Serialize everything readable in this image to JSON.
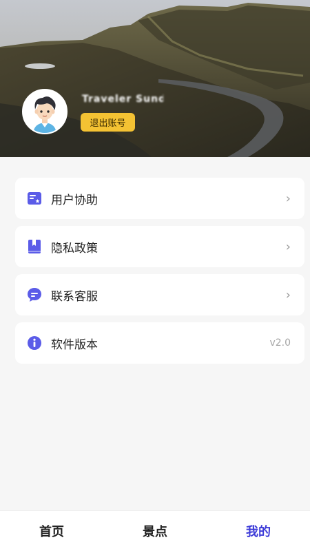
{
  "profile": {
    "username": "Traveler Sunde",
    "logout_label": "退出账号",
    "avatar_icon": "cartoon-boy-avatar"
  },
  "menu": {
    "items": [
      {
        "label": "用户协助",
        "icon": "doc-star-icon",
        "trailing": "›"
      },
      {
        "label": "隐私政策",
        "icon": "bookmark-book-icon",
        "trailing": "›"
      },
      {
        "label": "联系客服",
        "icon": "chat-bubble-icon",
        "trailing": "›"
      },
      {
        "label": "软件版本",
        "icon": "info-icon",
        "trailing": "v2.0"
      }
    ]
  },
  "tabbar": {
    "tabs": [
      {
        "label": "首页"
      },
      {
        "label": "景点"
      },
      {
        "label": "我的"
      }
    ],
    "active": "我的"
  },
  "colors": {
    "accent": "#3d3bd8",
    "icon": "#5b5ce8",
    "button": "#f4c233"
  }
}
